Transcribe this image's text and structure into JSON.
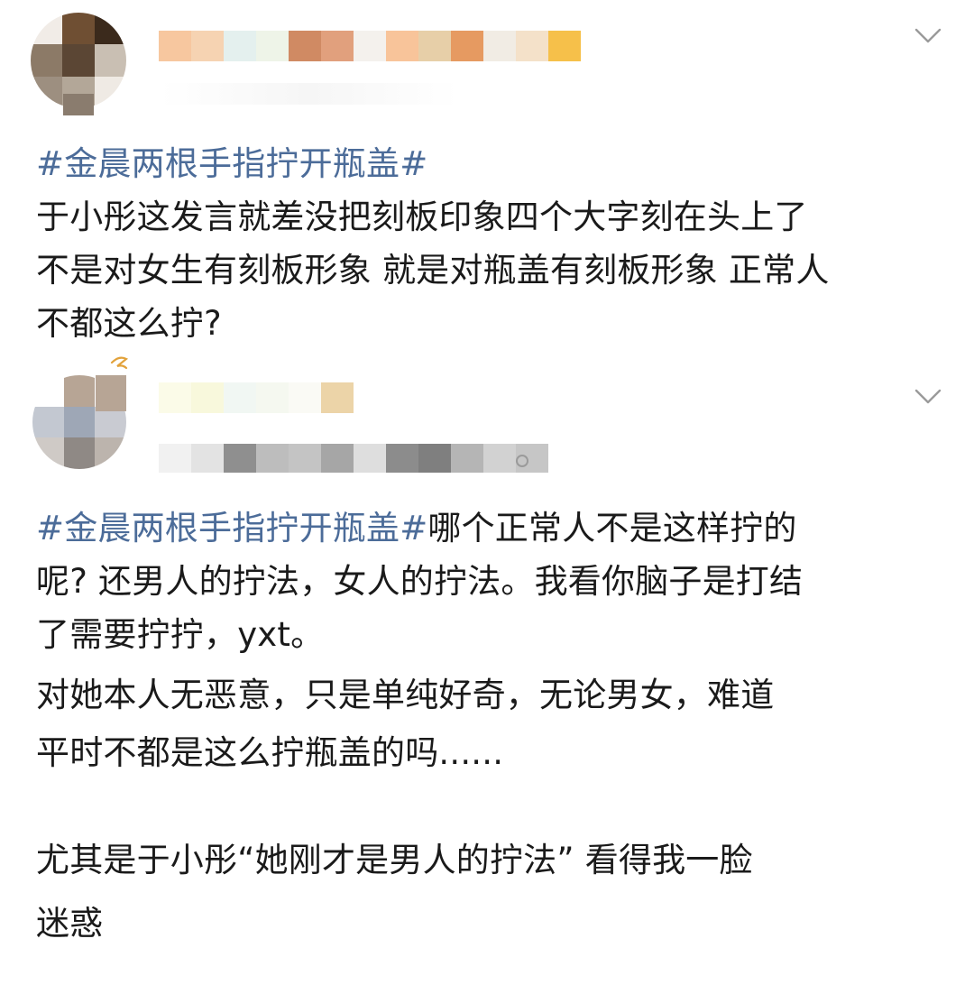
{
  "posts": [
    {
      "hashtag": "#金晨两根手指拧开瓶盖#",
      "lines": [
        "于小彤这发言就差没把刻板印象四个大字刻在头上了",
        "不是对女生有刻板形象 就是对瓶盖有刻板形象 正常人",
        "不都这么拧?"
      ],
      "avatar_colors": [
        "#f1ece7",
        "#6f4f33",
        "#3b2a1c",
        "#8c7a67",
        "#5b4634",
        "#c9bfb3",
        "#9d8f80",
        "#b3a798",
        "#efeae4"
      ],
      "name_colors": [
        "#f7c79f",
        "#f6d3b2",
        "#e4f0ee",
        "#eef4e8",
        "#d08a63",
        "#e1a07d",
        "#f4f1ed",
        "#f8c49a",
        "#e7cfa8",
        "#e69a61",
        "#f1ece4",
        "#f4e1c9",
        "#f6c04a"
      ]
    },
    {
      "hashtag": "#金晨两根手指拧开瓶盖#",
      "first_line_rest": "哪个正常人不是这样拧的",
      "lines": [
        "呢? 还男人的拧法，女人的拧法。我看你脑子是打结",
        "了需要拧拧，yxt。"
      ],
      "para2": [
        "对她本人无恶意，只是单纯好奇，无论男女，难道",
        "平时不都是这么拧瓶盖的吗......"
      ],
      "para3": [
        "尤其是于小彤“她刚才是男人的拧法” 看得我一脸",
        "迷惑"
      ],
      "avatar_colors": [
        "#ffffff",
        "#b7a595",
        "#ffffff",
        "#c3c8d1",
        "#9ea7b6",
        "#c9cbd2",
        "#cfcac6",
        "#8f8985",
        "#bcb4ad"
      ],
      "name_colors": [
        "#fbfbe8",
        "#f8f8dc",
        "#f1f7f3",
        "#f5f8f0",
        "#fafaf5",
        "#ecd4a8"
      ],
      "meta_colors": [
        "#f1f1f1",
        "#e3e3e3",
        "#8f8f8f",
        "#bdbdbd",
        "#c4c4c4",
        "#a6a6a6",
        "#dedede",
        "#8c8c8c",
        "#7f7f7f",
        "#b5b5b5",
        "#d2d2d2",
        "#c6c6c6"
      ]
    }
  ]
}
